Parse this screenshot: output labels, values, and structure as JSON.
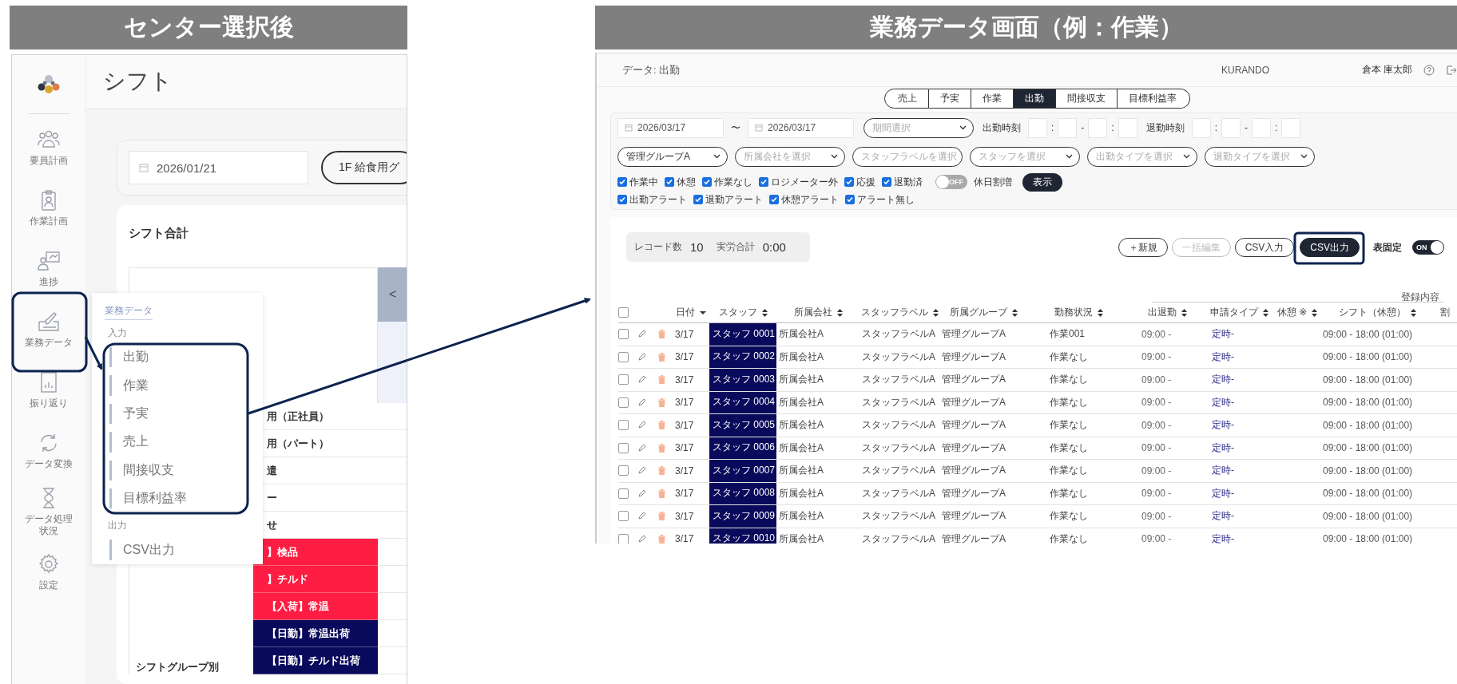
{
  "left_panel": {
    "heading": "センター選択後",
    "app": {
      "title": "シフト",
      "nav": [
        {
          "label": "要員計画"
        },
        {
          "label": "作業計画"
        },
        {
          "label": "進捗"
        },
        {
          "label": "業務データ"
        },
        {
          "label": "振り返り"
        },
        {
          "label": "データ変換"
        },
        {
          "label": "データ処理状況"
        },
        {
          "label": "設定"
        }
      ],
      "date": {
        "value": "2026/01/21"
      },
      "group_select": {
        "value": "1F 給食用グ"
      },
      "card_title": "シフト合計",
      "table": {
        "prev_button": "<",
        "group_label": "シフトグループ別",
        "rows": [
          {
            "label": "用（正社員）"
          },
          {
            "label": "用（パート）"
          },
          {
            "label": "遣"
          },
          {
            "label": "ー"
          },
          {
            "label": "せ"
          },
          {
            "label": "】検品",
            "color": "#ff1d43"
          },
          {
            "label": "】チルド",
            "color": "#ff1d43"
          },
          {
            "label": "【入荷】常温",
            "color": "#ff1d43"
          },
          {
            "label": "【日勤】常温出荷",
            "color": "#0a0a5c"
          },
          {
            "label": "【日勤】チルド出荷",
            "color": "#0a0a5c"
          }
        ]
      },
      "flyout": {
        "heading": "業務データ",
        "sections": [
          {
            "title": "入力",
            "items": [
              "出勤",
              "作業",
              "予実",
              "売上",
              "間接収支",
              "目標利益率"
            ]
          },
          {
            "title": "出力",
            "items": [
              "CSV出力"
            ]
          }
        ]
      }
    }
  },
  "right_panel": {
    "heading": "業務データ画面（例：作業）",
    "app": {
      "page_title": "データ: 出勤",
      "brand": "KURANDO",
      "user": "倉本 庫太郎",
      "tabs": [
        {
          "label": "売上",
          "selected": false
        },
        {
          "label": "予実",
          "selected": false
        },
        {
          "label": "作業",
          "selected": false
        },
        {
          "label": "出勤",
          "selected": true
        },
        {
          "label": "間接収支",
          "selected": false
        },
        {
          "label": "目標利益率",
          "selected": false
        }
      ],
      "filters": {
        "date_from": "2026/03/17",
        "range_mark": "〜",
        "date_to": "2026/03/17",
        "period": {
          "placeholder": "期間選択"
        },
        "clock_in": {
          "label": "出勤時刻",
          "separators": [
            ":",
            "-",
            ":"
          ]
        },
        "clock_out": {
          "label": "退勤時刻",
          "separators": [
            ":",
            "-",
            ":"
          ]
        },
        "selects": [
          {
            "value": "管理グループA"
          },
          {
            "placeholder": "所属会社を選択"
          },
          {
            "placeholder": "スタッフラベルを選択"
          },
          {
            "placeholder": "スタッフを選択"
          },
          {
            "placeholder": "出勤タイプを選択"
          },
          {
            "placeholder": "退勤タイプを選択"
          }
        ],
        "checkboxes": [
          {
            "label": "作業中",
            "checked": true
          },
          {
            "label": "休憩",
            "checked": true
          },
          {
            "label": "作業なし",
            "checked": true
          },
          {
            "label": "ロジメーター外",
            "checked": true
          },
          {
            "label": "応援",
            "checked": true
          },
          {
            "label": "退勤済",
            "checked": true
          }
        ],
        "holiday_toggle": {
          "text": "OFF",
          "label": "休日割増",
          "on": false
        },
        "show_button": "表示",
        "alert_checkboxes": [
          {
            "label": "出勤アラート",
            "checked": true
          },
          {
            "label": "退勤アラート",
            "checked": true
          },
          {
            "label": "休憩アラート",
            "checked": true
          },
          {
            "label": "アラート無し",
            "checked": true
          }
        ]
      },
      "summary": {
        "record_label": "レコード数",
        "record_value": "10",
        "total_label": "実労合計",
        "total_value": "0:00"
      },
      "actions": [
        {
          "label": "＋新規",
          "kind": "outline"
        },
        {
          "label": "一括編集",
          "kind": "disabled"
        },
        {
          "label": "CSV入力",
          "kind": "outline"
        },
        {
          "label": "CSV出力",
          "kind": "primary"
        }
      ],
      "pin_toggle": {
        "label": "表固定",
        "text": "ON",
        "on": true
      },
      "table": {
        "group_header": "登録内容",
        "select_all": {
          "checked": false
        },
        "columns": [
          {
            "label": "日付"
          },
          {
            "label": "スタッフ"
          },
          {
            "label": "所属会社"
          },
          {
            "label": "スタッフラベル"
          },
          {
            "label": "所属グループ"
          },
          {
            "label": "勤務状況"
          },
          {
            "label": "出退勤"
          },
          {
            "label": "申請タイプ"
          },
          {
            "label": "休憩 ※"
          },
          {
            "label": "シフト（休憩）"
          },
          {
            "label": "割"
          }
        ],
        "rows": [
          {
            "checked": false,
            "date": "3/17",
            "staff": "スタッフ 0001",
            "company": "所属会社A",
            "label": "スタッフラベルA",
            "group": "管理グループA",
            "status": "作業001",
            "clock": "09:00 -",
            "apply_type": "定時-",
            "shift": "09:00 - 18:00 (01:00)"
          },
          {
            "checked": false,
            "date": "3/17",
            "staff": "スタッフ 0002",
            "company": "所属会社A",
            "label": "スタッフラベルA",
            "group": "管理グループA",
            "status": "作業なし",
            "clock": "09:00 -",
            "apply_type": "定時-",
            "shift": "09:00 - 18:00 (01:00)"
          },
          {
            "checked": false,
            "date": "3/17",
            "staff": "スタッフ 0003",
            "company": "所属会社A",
            "label": "スタッフラベルA",
            "group": "管理グループA",
            "status": "作業なし",
            "clock": "09:00 -",
            "apply_type": "定時-",
            "shift": "09:00 - 18:00 (01:00)"
          },
          {
            "checked": false,
            "date": "3/17",
            "staff": "スタッフ 0004",
            "company": "所属会社A",
            "label": "スタッフラベルA",
            "group": "管理グループA",
            "status": "作業なし",
            "clock": "09:00 -",
            "apply_type": "定時-",
            "shift": "09:00 - 18:00 (01:00)"
          },
          {
            "checked": false,
            "date": "3/17",
            "staff": "スタッフ 0005",
            "company": "所属会社A",
            "label": "スタッフラベルA",
            "group": "管理グループA",
            "status": "作業なし",
            "clock": "09:00 -",
            "apply_type": "定時-",
            "shift": "09:00 - 18:00 (01:00)"
          },
          {
            "checked": false,
            "date": "3/17",
            "staff": "スタッフ 0006",
            "company": "所属会社A",
            "label": "スタッフラベルA",
            "group": "管理グループA",
            "status": "作業なし",
            "clock": "09:00 -",
            "apply_type": "定時-",
            "shift": "09:00 - 18:00 (01:00)"
          },
          {
            "checked": false,
            "date": "3/17",
            "staff": "スタッフ 0007",
            "company": "所属会社A",
            "label": "スタッフラベルA",
            "group": "管理グループA",
            "status": "作業なし",
            "clock": "09:00 -",
            "apply_type": "定時-",
            "shift": "09:00 - 18:00 (01:00)"
          },
          {
            "checked": false,
            "date": "3/17",
            "staff": "スタッフ 0008",
            "company": "所属会社A",
            "label": "スタッフラベルA",
            "group": "管理グループA",
            "status": "作業なし",
            "clock": "09:00 -",
            "apply_type": "定時-",
            "shift": "09:00 - 18:00 (01:00)"
          },
          {
            "checked": false,
            "date": "3/17",
            "staff": "スタッフ 0009",
            "company": "所属会社A",
            "label": "スタッフラベルA",
            "group": "管理グループA",
            "status": "作業なし",
            "clock": "09:00 -",
            "apply_type": "定時-",
            "shift": "09:00 - 18:00 (01:00)"
          },
          {
            "checked": false,
            "date": "3/17",
            "staff": "スタッフ 0010",
            "company": "所属会社A",
            "label": "スタッフラベルA",
            "group": "管理グループA",
            "status": "作業なし",
            "clock": "09:00 -",
            "apply_type": "定時-",
            "shift": "09:00 - 18:00 (01:00)"
          }
        ]
      }
    }
  }
}
